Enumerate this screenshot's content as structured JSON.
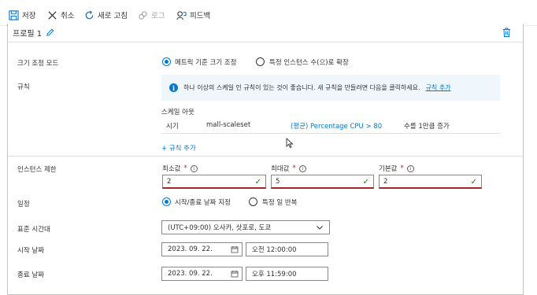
{
  "toolbar": {
    "save": "저장",
    "cancel": "취소",
    "refresh": "새로 고침",
    "logs": "로그",
    "feedback": "피드백"
  },
  "profile": {
    "title": "프로필 1"
  },
  "scale_mode": {
    "label": "크기 조정 모드",
    "option_metric": "메트릭 기준 크기 조정",
    "option_count": "특정 인스턴스 수(으)로 확장",
    "selected": "option_metric"
  },
  "rules": {
    "label": "규칙",
    "info_text": "하나 이상의 스케일 인 규칙이 있는 것이 좋습니다. 새 규칙을 만들려면 다음을 클릭하세요.",
    "info_link": "규칙 추가",
    "scale_out_heading": "스케일 아웃",
    "rule": {
      "when": "시기",
      "resource": "mall-scaleset",
      "metric": "(평균) Percentage CPU > 80",
      "action": "수를 1만큼 증가"
    },
    "add_rule": "+ 규칙 추가"
  },
  "instance_limits": {
    "label": "인스턴스 제한",
    "min_label": "최소값",
    "min_value": "2",
    "max_label": "최대값",
    "max_value": "5",
    "default_label": "기본값",
    "default_value": "2",
    "required_mark": "*"
  },
  "schedule": {
    "label": "일정",
    "option_dates": "시작/종료 날짜 지정",
    "option_repeat": "특정 일 반복",
    "selected": "option_dates"
  },
  "timezone": {
    "label": "표준 시간대",
    "value": "(UTC+09:00) 오사카, 삿포로, 도쿄"
  },
  "start": {
    "label": "시작 날짜",
    "date": "2023. 09. 22.",
    "time": "오전 12:00:00"
  },
  "end": {
    "label": "종료 날짜",
    "date": "2023. 09. 22.",
    "time": "오후 11:59:00"
  },
  "colors": {
    "accent": "#0078d4",
    "info_bg": "#eff6fc",
    "success": "#107c10",
    "error": "#a4262c"
  }
}
